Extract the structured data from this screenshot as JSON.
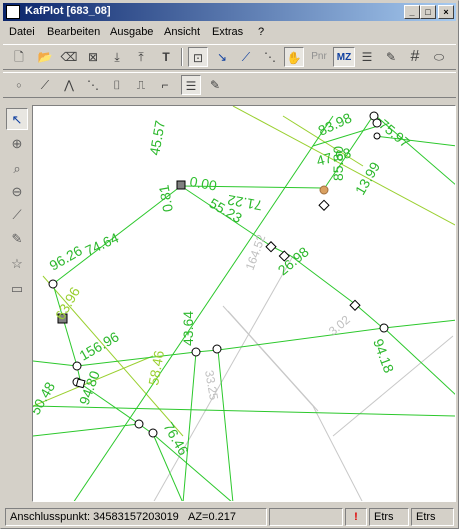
{
  "window": {
    "title": "KafPlot [683_08]"
  },
  "menu": [
    "Datei",
    "Bearbeiten",
    "Ausgabe",
    "Ansicht",
    "Extras",
    "?"
  ],
  "toolbar1": {
    "icons": [
      "new-file-icon",
      "open-folder-icon",
      "undo-icon",
      "delete-icon",
      "import-icon",
      "export-icon",
      "text-tool-icon",
      "point-select-icon",
      "arrow-line-icon",
      "angle-tool-icon",
      "dashed-line-icon",
      "hand-icon",
      "pnr-icon",
      "mz-icon",
      "document-icon",
      "edit-document-icon",
      "grid-icon",
      "ellipse-icon"
    ],
    "pnr": "Pnr",
    "mz": "MZ"
  },
  "toolbar2": {
    "icons": [
      "point-icon",
      "line-icon",
      "polyline-icon",
      "dashed-segment-icon",
      "bracket-icon",
      "step-icon",
      "step-line-icon",
      "list-document-icon",
      "edit-list-icon"
    ]
  },
  "sidebar": {
    "icons": [
      "pointer-icon",
      "crosshair-icon",
      "zoom-icon",
      "pan-icon",
      "ruler-icon",
      "pencil-icon",
      "star-icon",
      "rectangle-icon"
    ]
  },
  "canvas_labels": [
    {
      "text": "45.57",
      "color": "#2cb82c"
    },
    {
      "text": "0.00",
      "color": "#30c030"
    },
    {
      "text": "71.22",
      "color": "#2cb82c"
    },
    {
      "text": "55.23",
      "color": "#2cb82c"
    },
    {
      "text": "0.81",
      "color": "#2cb82c"
    },
    {
      "text": "74.64",
      "color": "#2cb82c"
    },
    {
      "text": "96.26",
      "color": "#2cb82c"
    },
    {
      "text": "75.97",
      "color": "#2cb82c"
    },
    {
      "text": "83.98",
      "color": "#2cb82c"
    },
    {
      "text": "47.68",
      "color": "#2cb82c"
    },
    {
      "text": "85.80",
      "color": "#2cb82c"
    },
    {
      "text": "13.99",
      "color": "#2cb82c"
    },
    {
      "text": "26.98",
      "color": "#2cb82c"
    },
    {
      "text": "164.52",
      "color": "#c0c0c0"
    },
    {
      "text": "43.64",
      "color": "#2cb82c"
    },
    {
      "text": "156.96",
      "color": "#2cb82c"
    },
    {
      "text": "94.18",
      "color": "#2cb82c"
    },
    {
      "text": "63.96",
      "color": "#9ad030"
    },
    {
      "text": "94.80",
      "color": "#2cb82c"
    },
    {
      "text": "76.46",
      "color": "#2cb82c"
    },
    {
      "text": "50.48",
      "color": "#2cb82c"
    },
    {
      "text": "58.46",
      "color": "#9ad030"
    },
    {
      "text": "33.25",
      "color": "#c0c0c0"
    },
    {
      "text": "3.02",
      "color": "#c0c0c0"
    }
  ],
  "status": {
    "anschluss": "Anschlusspunkt: 34583157203019",
    "az": "AZ=0.217",
    "warn": "!",
    "etrs1": "Etrs",
    "etrs2": "Etrs"
  }
}
